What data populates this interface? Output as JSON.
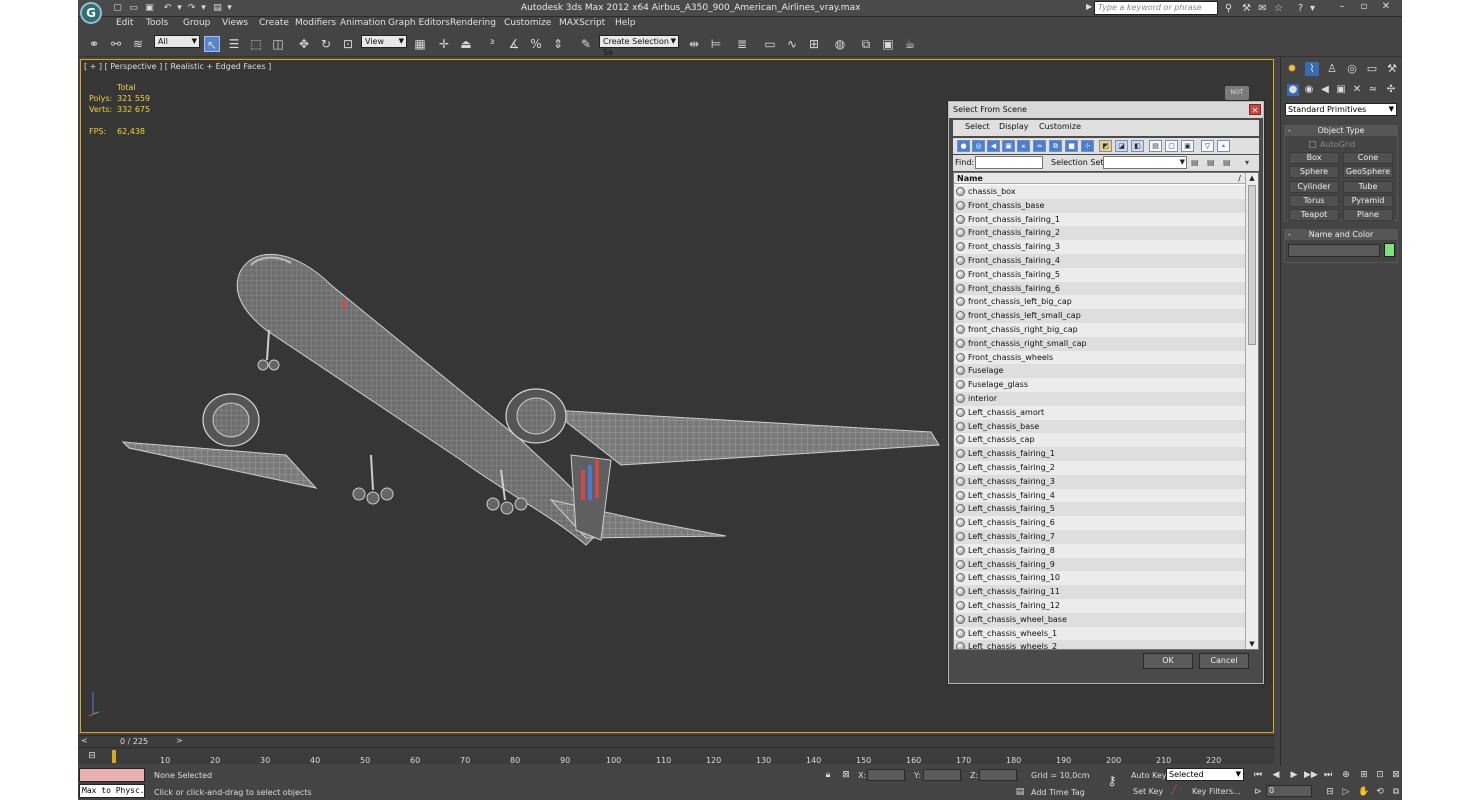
{
  "titlebar": {
    "title": "Autodesk 3ds Max  2012 x64     Airbus_A350_900_American_Airlines_vray.max",
    "search_placeholder": "Type a keyword or phrase",
    "logo": "3ds-max-logo"
  },
  "menu": {
    "items": [
      "Edit",
      "Tools",
      "Group",
      "Views",
      "Create",
      "Modifiers",
      "Animation",
      "Graph Editors",
      "Rendering",
      "Customize",
      "MAXScript",
      "Help"
    ]
  },
  "toolbar": {
    "selection_filter": "All",
    "ref_coord": "View",
    "named_selection": "Create Selection Se"
  },
  "viewport": {
    "label": "[ + ] [ Perspective ] [ Realistic + Edged Faces ]",
    "stats_header": "Total",
    "polys_label": "Polys:",
    "polys_value": "321 559",
    "verts_label": "Verts:",
    "verts_value": "332 675",
    "fps_label": "FPS:",
    "fps_value": "62,438",
    "nav_cube_label": "NOT"
  },
  "dialog": {
    "title": "Select From Scene",
    "menu": [
      "Select",
      "Display",
      "Customize"
    ],
    "find_label": "Find:",
    "selection_set_label": "Selection Set:",
    "column_name": "Name",
    "objects": [
      "chassis_box",
      "Front_chassis_base",
      "Front_chassis_fairing_1",
      "Front_chassis_fairing_2",
      "Front_chassis_fairing_3",
      "Front_chassis_fairing_4",
      "Front_chassis_fairing_5",
      "Front_chassis_fairing_6",
      "front_chassis_left_big_cap",
      "front_chassis_left_small_cap",
      "front_chassis_right_big_cap",
      "front_chassis_right_small_cap",
      "Front_chassis_wheels",
      "Fuselage",
      "Fuselage_glass",
      "interior",
      "Left_chassis_amort",
      "Left_chassis_base",
      "Left_chassis_cap",
      "Left_chassis_fairing_1",
      "Left_chassis_fairing_2",
      "Left_chassis_fairing_3",
      "Left_chassis_fairing_4",
      "Left_chassis_fairing_5",
      "Left_chassis_fairing_6",
      "Left_chassis_fairing_7",
      "Left_chassis_fairing_8",
      "Left_chassis_fairing_9",
      "Left_chassis_fairing_10",
      "Left_chassis_fairing_11",
      "Left_chassis_fairing_12",
      "Left_chassis_wheel_base",
      "Left_chassis_wheels_1",
      "Left_chassis_wheels_2"
    ],
    "ok": "OK",
    "cancel": "Cancel"
  },
  "timeline": {
    "frame_counter": "0 / 225",
    "ticks": [
      "10",
      "20",
      "30",
      "40",
      "50",
      "60",
      "70",
      "80",
      "90",
      "100",
      "110",
      "120",
      "130",
      "140",
      "150",
      "160",
      "170",
      "180",
      "190",
      "200",
      "210",
      "220"
    ]
  },
  "status": {
    "maxscript_label": "Max to Physc.",
    "selection": "None Selected",
    "prompt": "Click or click-and-drag to select objects",
    "x_label": "X:",
    "y_label": "Y:",
    "z_label": "Z:",
    "grid": "Grid = 10,0cm",
    "add_time_tag": "Add Time Tag",
    "auto_key": "Auto Key",
    "set_key": "Set Key",
    "selected_dd": "Selected",
    "key_filters": "Key Filters...",
    "frame_value": "0"
  },
  "command_panel": {
    "category": "Standard Primitives",
    "object_type_title": "Object Type",
    "autogrid": "AutoGrid",
    "primitives": [
      "Box",
      "Cone",
      "Sphere",
      "GeoSphere",
      "Cylinder",
      "Tube",
      "Torus",
      "Pyramid",
      "Teapot",
      "Plane"
    ],
    "name_color_title": "Name and Color",
    "object_color": "#7ee07e"
  },
  "colors": {
    "viewport_border": "#d9a81e",
    "stats": "#f2d23a",
    "selected_tool": "#5a86c8"
  }
}
